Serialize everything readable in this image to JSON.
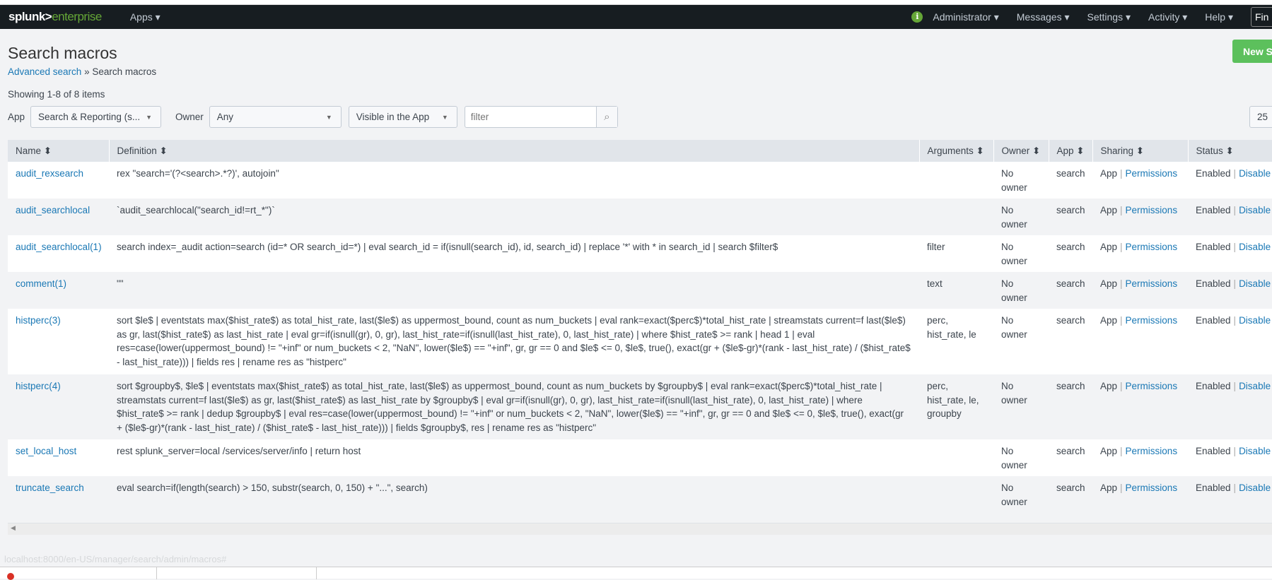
{
  "nav": {
    "logo_main": "splunk>",
    "logo_sub": "enterprise",
    "apps": "Apps ▾",
    "right_items": [
      "Administrator ▾",
      "Messages ▾",
      "Settings ▾",
      "Activity ▾",
      "Help ▾"
    ],
    "find": "Fin"
  },
  "page": {
    "title": "Search macros",
    "breadcrumb_link": "Advanced search",
    "breadcrumb_sep": " » ",
    "breadcrumb_current": "Search macros",
    "new_button": "New Search Macro",
    "count": "Showing 1-8 of 8 items"
  },
  "filters": {
    "app_label": "App",
    "app_value": "Search & Reporting (s...",
    "owner_label": "Owner",
    "owner_value": "Any",
    "visibility_value": "Visible in the App",
    "filter_placeholder": "filter",
    "per_page": "25"
  },
  "table": {
    "headers": [
      "Name ⬍",
      "Definition ⬍",
      "Arguments ⬍",
      "Owner ⬍",
      "App ⬍",
      "Sharing ⬍",
      "Status ⬍"
    ],
    "rows": [
      {
        "name": "audit_rexsearch",
        "definition": "rex \"search='(?<search>.*?)', autojoin\"",
        "arguments": "",
        "owner": "No owner",
        "app": "search",
        "sharing": "App",
        "permissions": "Permissions",
        "status": "Enabled",
        "action": "Disable"
      },
      {
        "name": "audit_searchlocal",
        "definition": "`audit_searchlocal(\"search_id!=rt_*\")`",
        "arguments": "",
        "owner": "No owner",
        "app": "search",
        "sharing": "App",
        "permissions": "Permissions",
        "status": "Enabled",
        "action": "Disable"
      },
      {
        "name": "audit_searchlocal(1)",
        "definition": "search index=_audit action=search (id=* OR search_id=*) | eval search_id = if(isnull(search_id), id, search_id) | replace '*' with * in search_id | search $filter$",
        "arguments": "filter",
        "owner": "No owner",
        "app": "search",
        "sharing": "App",
        "permissions": "Permissions",
        "status": "Enabled",
        "action": "Disable"
      },
      {
        "name": "comment(1)",
        "definition": "\"\"",
        "arguments": "text",
        "owner": "No owner",
        "app": "search",
        "sharing": "App",
        "permissions": "Permissions",
        "status": "Enabled",
        "action": "Disable"
      },
      {
        "name": "histperc(3)",
        "definition": "sort $le$ | eventstats max($hist_rate$) as total_hist_rate, last($le$) as uppermost_bound, count as num_buckets | eval rank=exact($perc$)*total_hist_rate | streamstats current=f last($le$) as gr, last($hist_rate$) as last_hist_rate | eval gr=if(isnull(gr), 0, gr), last_hist_rate=if(isnull(last_hist_rate), 0, last_hist_rate) | where $hist_rate$ >= rank | head 1 | eval res=case(lower(uppermost_bound) != \"+inf\" or num_buckets < 2, \"NaN\", lower($le$) == \"+inf\", gr, gr == 0 and $le$ <= 0, $le$, true(), exact(gr + ($le$-gr)*(rank - last_hist_rate) / ($hist_rate$ - last_hist_rate))) | fields res | rename res as \"histperc\"",
        "arguments": "perc, hist_rate, le",
        "owner": "No owner",
        "app": "search",
        "sharing": "App",
        "permissions": "Permissions",
        "status": "Enabled",
        "action": "Disable"
      },
      {
        "name": "histperc(4)",
        "definition": "sort $groupby$, $le$ | eventstats max($hist_rate$) as total_hist_rate, last($le$) as uppermost_bound, count as num_buckets by $groupby$ | eval rank=exact($perc$)*total_hist_rate | streamstats current=f last($le$) as gr, last($hist_rate$) as last_hist_rate by $groupby$ | eval gr=if(isnull(gr), 0, gr), last_hist_rate=if(isnull(last_hist_rate), 0, last_hist_rate) | where $hist_rate$ >= rank | dedup $groupby$ | eval res=case(lower(uppermost_bound) != \"+inf\" or num_buckets < 2, \"NaN\", lower($le$) == \"+inf\", gr, gr == 0 and $le$ <= 0, $le$, true(), exact(gr + ($le$-gr)*(rank - last_hist_rate) / ($hist_rate$ - last_hist_rate))) | fields $groupby$, res | rename res as \"histperc\"",
        "arguments": "perc, hist_rate, le, groupby",
        "owner": "No owner",
        "app": "search",
        "sharing": "App",
        "permissions": "Permissions",
        "status": "Enabled",
        "action": "Disable"
      },
      {
        "name": "set_local_host",
        "definition": "rest splunk_server=local /services/server/info | return host",
        "arguments": "",
        "owner": "No owner",
        "app": "search",
        "sharing": "App",
        "permissions": "Permissions",
        "status": "Enabled",
        "action": "Disable"
      },
      {
        "name": "truncate_search",
        "definition": "eval search=if(length(search) > 150, substr(search, 0, 150) + \"...\", search)",
        "arguments": "",
        "owner": "No owner",
        "app": "search",
        "sharing": "App",
        "permissions": "Permissions",
        "status": "Enabled",
        "action": "Disable"
      }
    ]
  },
  "status_url": "localhost:8000/en-US/manager/search/admin/macros#"
}
